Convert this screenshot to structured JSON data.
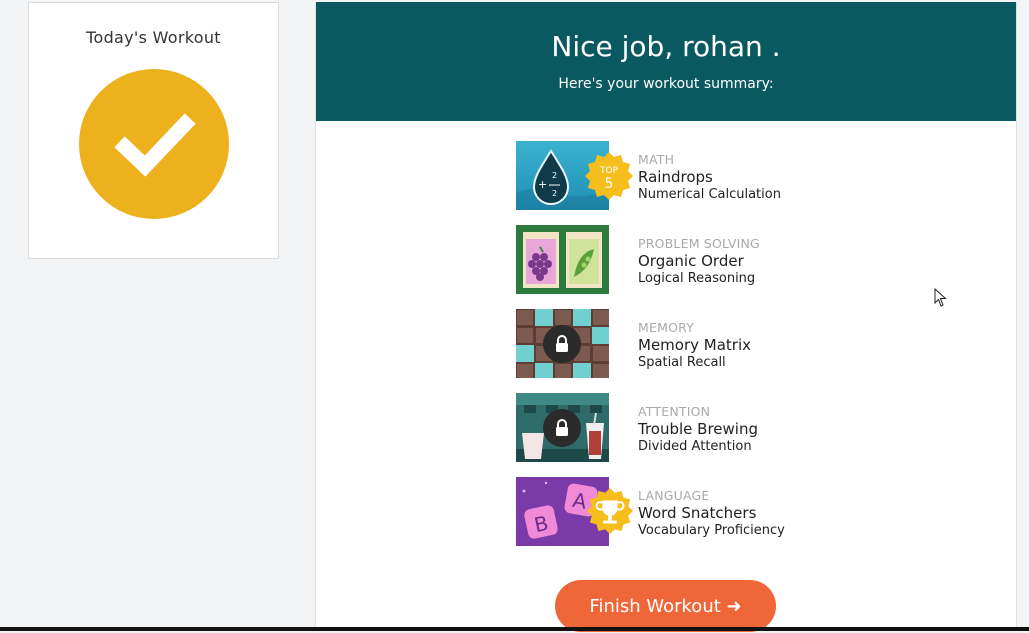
{
  "colors": {
    "banner": "#0b5960",
    "check": "#ecb11d",
    "button": "#ef6639"
  },
  "today": {
    "title": "Today's Workout"
  },
  "banner": {
    "title": "Nice job, rohan .",
    "subtitle": "Here's your workout summary:"
  },
  "games": [
    {
      "category": "MATH",
      "name": "Raindrops",
      "skill": "Numerical Calculation",
      "badge": "TOP",
      "badge_num": "5",
      "badge_icon": "top-5-badge",
      "locked": false
    },
    {
      "category": "PROBLEM SOLVING",
      "name": "Organic Order",
      "skill": "Logical Reasoning",
      "locked": false
    },
    {
      "category": "MEMORY",
      "name": "Memory Matrix",
      "skill": "Spatial Recall",
      "locked": true
    },
    {
      "category": "ATTENTION",
      "name": "Trouble Brewing",
      "skill": "Divided Attention",
      "locked": true
    },
    {
      "category": "LANGUAGE",
      "name": "Word Snatchers",
      "skill": "Vocabulary Proficiency",
      "badge_icon": "trophy-icon",
      "locked": false
    }
  ],
  "finish": {
    "label": "Finish Workout ➜"
  }
}
